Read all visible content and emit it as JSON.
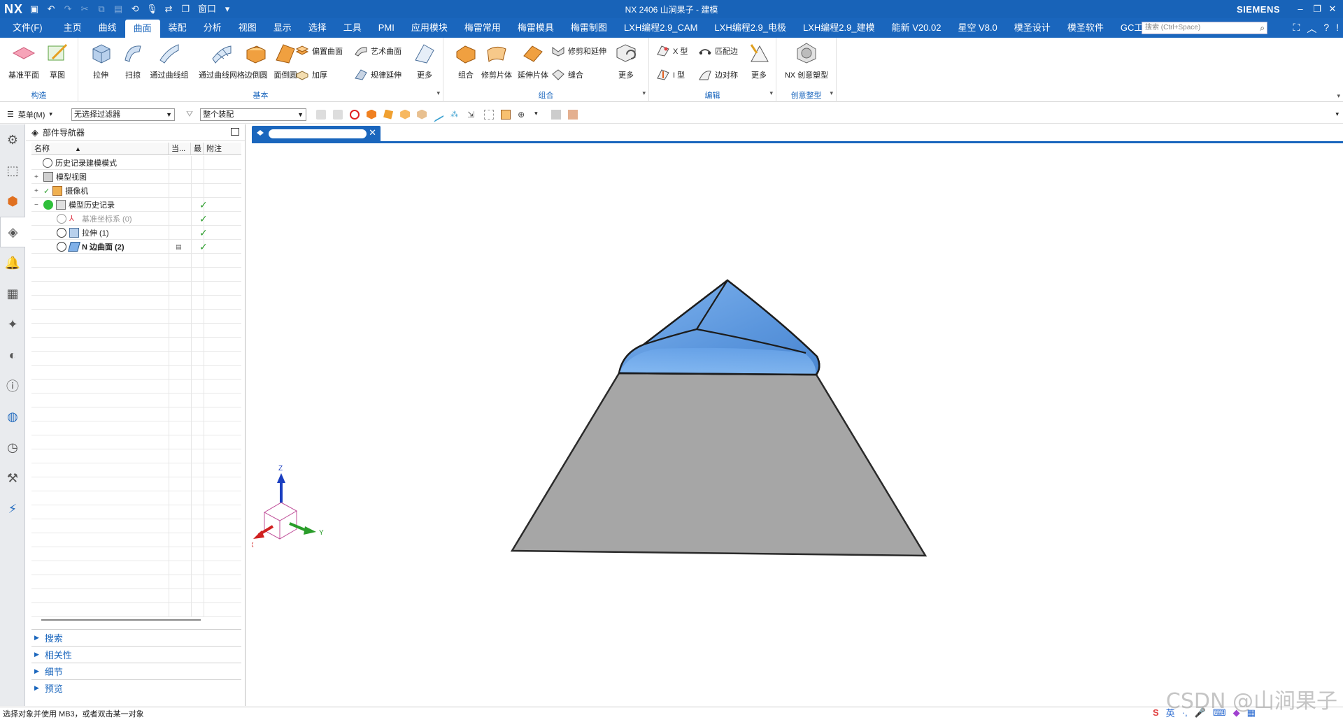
{
  "titlebar": {
    "logo": "NX",
    "window_menu": "窗口",
    "title": "NX 2406 山涧果子 - 建模",
    "brand": "SIEMENS"
  },
  "menubar": {
    "file": "文件(F)",
    "tabs": [
      "主页",
      "曲线",
      "曲面",
      "装配",
      "分析",
      "视图",
      "显示",
      "选择",
      "工具",
      "PMI",
      "应用模块",
      "梅雷常用",
      "梅雷模具",
      "梅雷制图",
      "LXH编程2.9_CAM",
      "LXH编程2.9_电极",
      "LXH编程2.9_建模",
      "能新 V20.02",
      "星空 V8.0",
      "模圣设计",
      "模圣软件",
      "GC工具箱"
    ],
    "active_tab": "曲面",
    "search_placeholder": "搜索 (Ctrl+Space)"
  },
  "ribbon": {
    "groups": {
      "construct": "构造",
      "basic": "基本",
      "combine": "组合",
      "edit": "编辑",
      "creative": "创意整型"
    },
    "buttons": {
      "datum_plane": "基准平面",
      "sketch": "草图",
      "extrude": "拉伸",
      "sweep": "扫掠",
      "through_curves": "通过曲线组",
      "through_curve_mesh": "通过曲线网格",
      "fillet": "边倒圆",
      "face_fillet": "面倒圆",
      "offset_surface": "偏置曲面",
      "thicken": "加厚",
      "studio_surface": "艺术曲面",
      "law_extension": "规律延伸",
      "more1": "更多",
      "unite": "组合",
      "trim_sheet": "修剪片体",
      "extend_sheet": "延伸片体",
      "trim_extend": "修剪和延伸",
      "sew": "缝合",
      "more2": "更多",
      "x_form": "X 型",
      "i_form": "I 型",
      "match_edge": "匹配边",
      "edge_symmetry": "边对称",
      "more3": "更多",
      "nx_realize": "NX 创意塑型"
    }
  },
  "toolbar": {
    "menu": "菜单(M)",
    "filter": "无选择过滤器",
    "scope": "整个装配"
  },
  "navigator": {
    "title": "部件导航器",
    "columns": [
      "名称",
      "当...",
      "最",
      "附注"
    ],
    "rows": [
      {
        "label": "历史记录建模模式",
        "check": false
      },
      {
        "label": "模型视图",
        "check": false
      },
      {
        "label": "摄像机",
        "check": false
      },
      {
        "label": "模型历史记录",
        "check": true
      },
      {
        "label": "基准坐标系 (0)",
        "check": true
      },
      {
        "label": "拉伸 (1)",
        "check": true
      },
      {
        "label": "N 边曲面 (2)",
        "check": true
      }
    ],
    "sections": [
      "搜索",
      "相关性",
      "细节",
      "预览"
    ]
  },
  "axes": {
    "z": "Z",
    "y": "Y",
    "x": "X"
  },
  "status": {
    "message": "选择对象并使用 MB3，或者双击某一对象",
    "watermark": "CSDN @山涧果子",
    "ime": "英"
  },
  "colors": {
    "brand_blue": "#1a66bd",
    "surface_blue": "#5b96dd",
    "body_gray": "#a6a6a6",
    "check_green": "#2a9d2a"
  }
}
